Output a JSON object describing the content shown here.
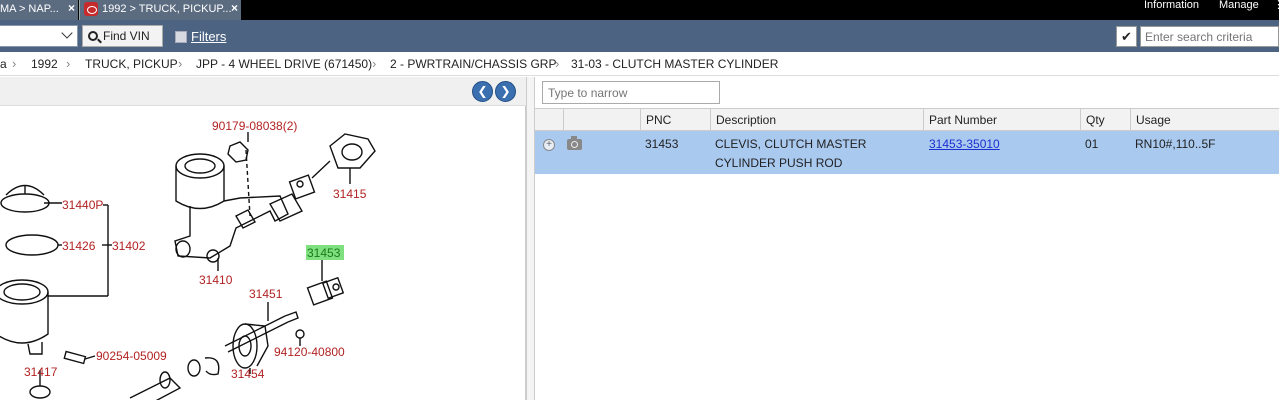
{
  "tabs": [
    {
      "label": "MA > NAP..."
    },
    {
      "label": "1992 > TRUCK, PICKUP..."
    }
  ],
  "topmenu": {
    "information": "Information",
    "manage": "Manage",
    "more": "⋮"
  },
  "toolbar": {
    "find_vin": "Find VIN",
    "filters": "Filters",
    "search_placeholder": "Enter search criteria"
  },
  "breadcrumb": [
    "a",
    "1992",
    "TRUCK, PICKUP",
    "JPP - 4 WHEEL DRIVE (671450)",
    "2 - PWRTRAIN/CHASSIS GRP",
    "31-03 - CLUTCH MASTER CYLINDER"
  ],
  "narrow_placeholder": "Type to narrow",
  "diagram": {
    "callouts": [
      "90179-08038(2)",
      "31415",
      "31440P",
      "31426",
      "31402",
      "31410",
      "31453",
      "31451",
      "94120-40800",
      "90254-05009",
      "31454",
      "31417"
    ]
  },
  "grid": {
    "headers": {
      "pnc": "PNC",
      "description": "Description",
      "part_number": "Part Number",
      "qty": "Qty",
      "usage": "Usage"
    },
    "rows": [
      {
        "pnc": "31453",
        "description_line1": "CLEVIS, CLUTCH MASTER",
        "description_line2": "CYLINDER PUSH ROD",
        "part_number": "31453-35010",
        "qty": "01",
        "usage": "RN10#,110..5F"
      }
    ]
  },
  "colors": {
    "toolbar": "#4d6382",
    "selected_row": "#a9c9ef",
    "callout": "#b22222",
    "highlight": "#7ee07e"
  }
}
